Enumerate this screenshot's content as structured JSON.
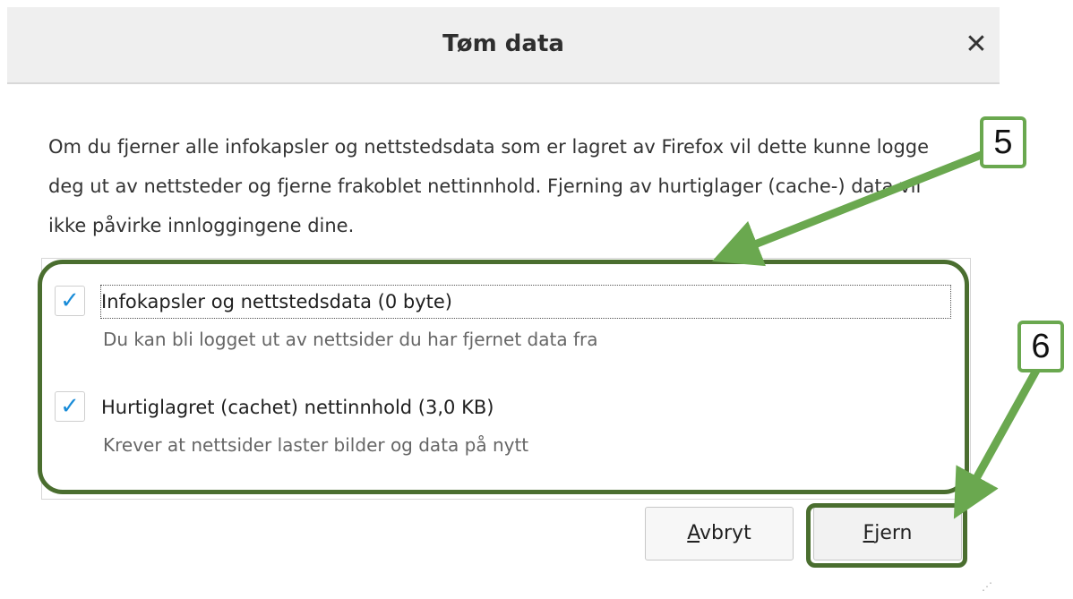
{
  "dialog": {
    "title": "Tøm data",
    "close_glyph": "✕",
    "description": "Om du fjerner alle infokapsler og nettstedsdata som er lagret av Firefox vil dette kunne logge deg ut av nettsteder og fjerne frakoblet nettinnhold. Fjerning av hurtiglager (cache-) data vil ikke påvirke innloggingene dine.",
    "options": [
      {
        "label": "Infokapsler og nettstedsdata (0 byte)",
        "hint": "Du kan bli logget ut av nettsider du har fjernet data fra",
        "checked": true
      },
      {
        "label": "Hurtiglagret (cachet) nettinnhold (3,0 KB)",
        "hint": "Krever at nettsider laster bilder og data på nytt",
        "checked": true
      }
    ],
    "check_glyph": "✓",
    "buttons": {
      "cancel_mnemonic": "A",
      "cancel_rest": "vbryt",
      "remove_mnemonic": "F",
      "remove_rest": "jern"
    }
  },
  "annotations": {
    "step_a": "5",
    "step_b": "6",
    "color": "#6aa84f",
    "ring_color": "#4a6e2f"
  }
}
